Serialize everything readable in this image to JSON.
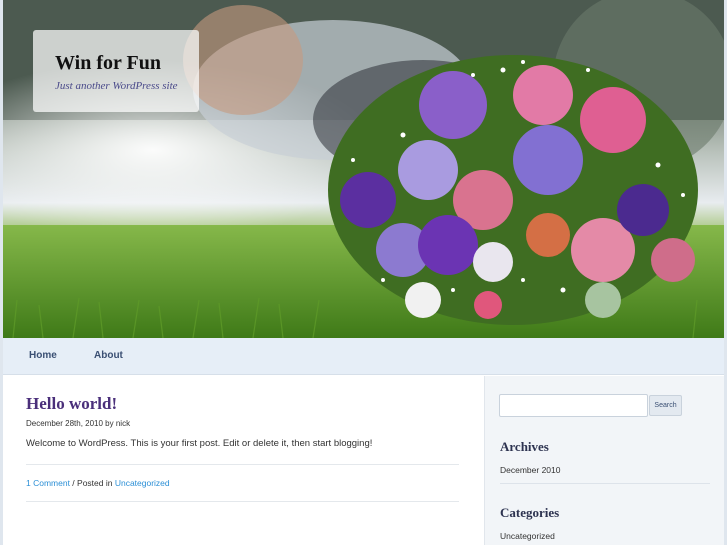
{
  "site": {
    "title": "Win for Fun",
    "tagline": "Just another WordPress site"
  },
  "nav": {
    "items": [
      {
        "label": "Home"
      },
      {
        "label": "About"
      }
    ]
  },
  "post": {
    "title": "Hello world!",
    "date": "December 28th, 2010",
    "by": "by",
    "author": "nick",
    "body": "Welcome to WordPress. This is your first post. Edit or delete it, then start blogging!",
    "comments_link": "1 Comment",
    "posted_in_text": " / Posted in ",
    "category_link": "Uncategorized"
  },
  "sidebar": {
    "search": {
      "value": "",
      "button_label": "Search"
    },
    "archives": {
      "title": "Archives",
      "items": [
        {
          "label": "December 2010"
        }
      ]
    },
    "categories": {
      "title": "Categories",
      "items": [
        {
          "label": "Uncategorized"
        }
      ]
    }
  },
  "colors": {
    "accent": "#4a2f7a",
    "link": "#2b8fd6",
    "nav_bg": "#e6eef7"
  }
}
